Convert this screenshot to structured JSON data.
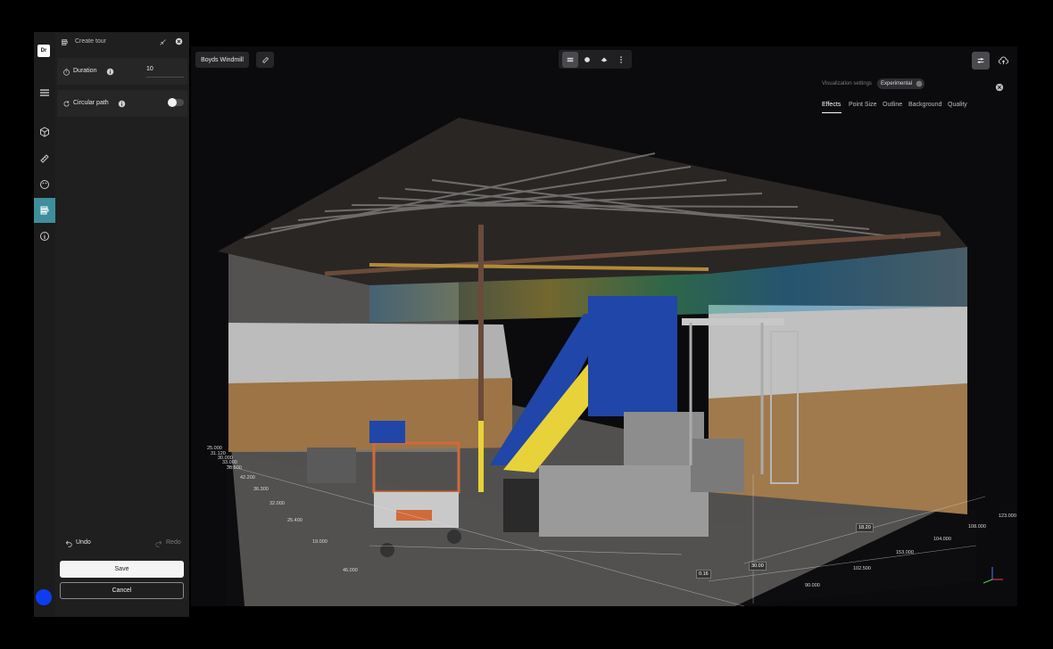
{
  "rail": {
    "logo": "Dr",
    "items": [
      {
        "name": "menu-icon"
      },
      {
        "name": "cube-icon"
      },
      {
        "name": "ruler-icon"
      },
      {
        "name": "palette-icon"
      },
      {
        "name": "tour-icon",
        "active": true
      },
      {
        "name": "info-icon"
      }
    ]
  },
  "panel": {
    "title": "Create tour",
    "duration_label": "Duration",
    "duration_value": "10",
    "circular_label": "Circular path",
    "circular_enabled": false,
    "undo_label": "Undo",
    "redo_label": "Redo",
    "save_label": "Save",
    "cancel_label": "Cancel"
  },
  "viewer": {
    "project_name": "Boyds Windmill",
    "toolbar_icons": [
      "layers-icon",
      "sphere-icon",
      "stack-icon",
      "more-icon"
    ],
    "viz_label": "Visualization settings",
    "experimental_badge": "Experimental",
    "tabs": [
      "Effects",
      "Point Size",
      "Outline",
      "Background",
      "Quality"
    ],
    "active_tab": "Effects",
    "coords_left": [
      "25.000",
      "31.120",
      "30.000",
      "33.000",
      "36.500",
      "42.200",
      "36.300",
      "32.000",
      "25.400",
      "19.000",
      "46.000"
    ],
    "coords_right": [
      "123.000",
      "108.000",
      "104.000",
      "153.000",
      "102.500",
      "90.000"
    ],
    "coords_bottom": [
      "0.16",
      "30.00"
    ],
    "measurement": "18.20"
  },
  "colors": {
    "accent": "#3d8f9c",
    "avatar": "#0f3cf2"
  }
}
